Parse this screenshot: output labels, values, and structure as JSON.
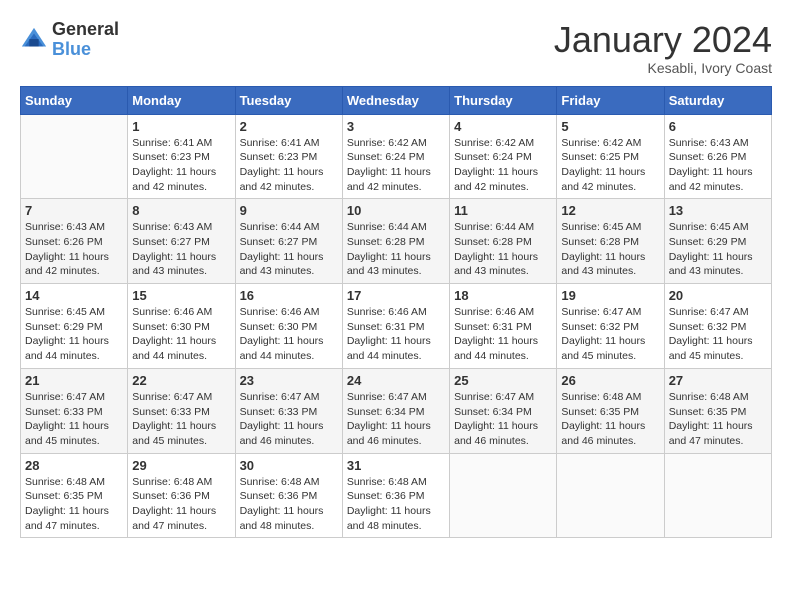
{
  "header": {
    "logo_general": "General",
    "logo_blue": "Blue",
    "title": "January 2024",
    "subtitle": "Kesabli, Ivory Coast"
  },
  "calendar": {
    "days_of_week": [
      "Sunday",
      "Monday",
      "Tuesday",
      "Wednesday",
      "Thursday",
      "Friday",
      "Saturday"
    ],
    "weeks": [
      [
        {
          "day": "",
          "sunrise": "",
          "sunset": "",
          "daylight": ""
        },
        {
          "day": "1",
          "sunrise": "Sunrise: 6:41 AM",
          "sunset": "Sunset: 6:23 PM",
          "daylight": "Daylight: 11 hours and 42 minutes."
        },
        {
          "day": "2",
          "sunrise": "Sunrise: 6:41 AM",
          "sunset": "Sunset: 6:23 PM",
          "daylight": "Daylight: 11 hours and 42 minutes."
        },
        {
          "day": "3",
          "sunrise": "Sunrise: 6:42 AM",
          "sunset": "Sunset: 6:24 PM",
          "daylight": "Daylight: 11 hours and 42 minutes."
        },
        {
          "day": "4",
          "sunrise": "Sunrise: 6:42 AM",
          "sunset": "Sunset: 6:24 PM",
          "daylight": "Daylight: 11 hours and 42 minutes."
        },
        {
          "day": "5",
          "sunrise": "Sunrise: 6:42 AM",
          "sunset": "Sunset: 6:25 PM",
          "daylight": "Daylight: 11 hours and 42 minutes."
        },
        {
          "day": "6",
          "sunrise": "Sunrise: 6:43 AM",
          "sunset": "Sunset: 6:26 PM",
          "daylight": "Daylight: 11 hours and 42 minutes."
        }
      ],
      [
        {
          "day": "7",
          "sunrise": "Sunrise: 6:43 AM",
          "sunset": "Sunset: 6:26 PM",
          "daylight": "Daylight: 11 hours and 42 minutes."
        },
        {
          "day": "8",
          "sunrise": "Sunrise: 6:43 AM",
          "sunset": "Sunset: 6:27 PM",
          "daylight": "Daylight: 11 hours and 43 minutes."
        },
        {
          "day": "9",
          "sunrise": "Sunrise: 6:44 AM",
          "sunset": "Sunset: 6:27 PM",
          "daylight": "Daylight: 11 hours and 43 minutes."
        },
        {
          "day": "10",
          "sunrise": "Sunrise: 6:44 AM",
          "sunset": "Sunset: 6:28 PM",
          "daylight": "Daylight: 11 hours and 43 minutes."
        },
        {
          "day": "11",
          "sunrise": "Sunrise: 6:44 AM",
          "sunset": "Sunset: 6:28 PM",
          "daylight": "Daylight: 11 hours and 43 minutes."
        },
        {
          "day": "12",
          "sunrise": "Sunrise: 6:45 AM",
          "sunset": "Sunset: 6:28 PM",
          "daylight": "Daylight: 11 hours and 43 minutes."
        },
        {
          "day": "13",
          "sunrise": "Sunrise: 6:45 AM",
          "sunset": "Sunset: 6:29 PM",
          "daylight": "Daylight: 11 hours and 43 minutes."
        }
      ],
      [
        {
          "day": "14",
          "sunrise": "Sunrise: 6:45 AM",
          "sunset": "Sunset: 6:29 PM",
          "daylight": "Daylight: 11 hours and 44 minutes."
        },
        {
          "day": "15",
          "sunrise": "Sunrise: 6:46 AM",
          "sunset": "Sunset: 6:30 PM",
          "daylight": "Daylight: 11 hours and 44 minutes."
        },
        {
          "day": "16",
          "sunrise": "Sunrise: 6:46 AM",
          "sunset": "Sunset: 6:30 PM",
          "daylight": "Daylight: 11 hours and 44 minutes."
        },
        {
          "day": "17",
          "sunrise": "Sunrise: 6:46 AM",
          "sunset": "Sunset: 6:31 PM",
          "daylight": "Daylight: 11 hours and 44 minutes."
        },
        {
          "day": "18",
          "sunrise": "Sunrise: 6:46 AM",
          "sunset": "Sunset: 6:31 PM",
          "daylight": "Daylight: 11 hours and 44 minutes."
        },
        {
          "day": "19",
          "sunrise": "Sunrise: 6:47 AM",
          "sunset": "Sunset: 6:32 PM",
          "daylight": "Daylight: 11 hours and 45 minutes."
        },
        {
          "day": "20",
          "sunrise": "Sunrise: 6:47 AM",
          "sunset": "Sunset: 6:32 PM",
          "daylight": "Daylight: 11 hours and 45 minutes."
        }
      ],
      [
        {
          "day": "21",
          "sunrise": "Sunrise: 6:47 AM",
          "sunset": "Sunset: 6:33 PM",
          "daylight": "Daylight: 11 hours and 45 minutes."
        },
        {
          "day": "22",
          "sunrise": "Sunrise: 6:47 AM",
          "sunset": "Sunset: 6:33 PM",
          "daylight": "Daylight: 11 hours and 45 minutes."
        },
        {
          "day": "23",
          "sunrise": "Sunrise: 6:47 AM",
          "sunset": "Sunset: 6:33 PM",
          "daylight": "Daylight: 11 hours and 46 minutes."
        },
        {
          "day": "24",
          "sunrise": "Sunrise: 6:47 AM",
          "sunset": "Sunset: 6:34 PM",
          "daylight": "Daylight: 11 hours and 46 minutes."
        },
        {
          "day": "25",
          "sunrise": "Sunrise: 6:47 AM",
          "sunset": "Sunset: 6:34 PM",
          "daylight": "Daylight: 11 hours and 46 minutes."
        },
        {
          "day": "26",
          "sunrise": "Sunrise: 6:48 AM",
          "sunset": "Sunset: 6:35 PM",
          "daylight": "Daylight: 11 hours and 46 minutes."
        },
        {
          "day": "27",
          "sunrise": "Sunrise: 6:48 AM",
          "sunset": "Sunset: 6:35 PM",
          "daylight": "Daylight: 11 hours and 47 minutes."
        }
      ],
      [
        {
          "day": "28",
          "sunrise": "Sunrise: 6:48 AM",
          "sunset": "Sunset: 6:35 PM",
          "daylight": "Daylight: 11 hours and 47 minutes."
        },
        {
          "day": "29",
          "sunrise": "Sunrise: 6:48 AM",
          "sunset": "Sunset: 6:36 PM",
          "daylight": "Daylight: 11 hours and 47 minutes."
        },
        {
          "day": "30",
          "sunrise": "Sunrise: 6:48 AM",
          "sunset": "Sunset: 6:36 PM",
          "daylight": "Daylight: 11 hours and 48 minutes."
        },
        {
          "day": "31",
          "sunrise": "Sunrise: 6:48 AM",
          "sunset": "Sunset: 6:36 PM",
          "daylight": "Daylight: 11 hours and 48 minutes."
        },
        {
          "day": "",
          "sunrise": "",
          "sunset": "",
          "daylight": ""
        },
        {
          "day": "",
          "sunrise": "",
          "sunset": "",
          "daylight": ""
        },
        {
          "day": "",
          "sunrise": "",
          "sunset": "",
          "daylight": ""
        }
      ]
    ]
  }
}
